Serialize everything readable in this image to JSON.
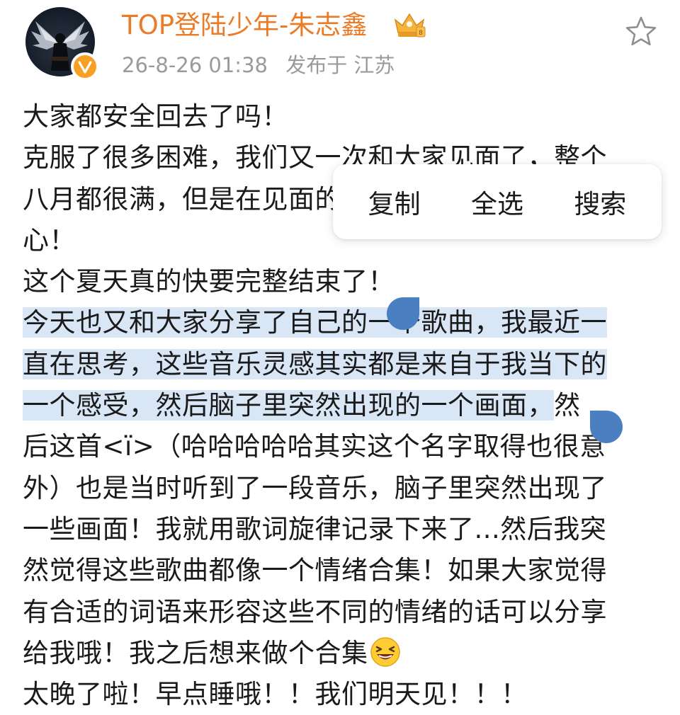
{
  "user": {
    "name": "TOP登陆少年-朱志鑫",
    "verified_color": "#f7a023",
    "name_color": "#ec7b28",
    "badge_icon": "crown-badge-icon"
  },
  "meta": {
    "timestamp": "26-8-26 01:38",
    "location": "发布于 江苏"
  },
  "context_menu": {
    "copy": "复制",
    "select_all": "全选",
    "search": "搜索"
  },
  "post": {
    "lines": [
      "大家都安全回去了吗！",
      "克服了很多困难，我们又一次和大家见面了，整个",
      "八月都很满，但是在见面的时候都非常非常开",
      "心！",
      "这个夏天真的快要完整结束了！",
      "今天也又和大家分享了自己的一个歌曲，我最近一",
      "直在思考，这些音乐灵感其实都是来自于我当下的",
      "一个感受，然后脑子里突然出现的一个画面，",
      "然",
      "后这首<ï>（哈哈哈哈哈其实这个名字取得也很意",
      "外）也是当时听到了一段音乐，脑子里突然出现了",
      "一些画面！我就用歌词旋律记录下来了...然后我突",
      "然觉得这些歌曲都像一个情绪合集！如果大家觉得",
      "有合适的词语来形容这些不同的情绪的话可以分享",
      "给我哦！我之后想来做个合集",
      "太晚了啦！早点睡哦！！我们明天见！！！"
    ],
    "selection_color": "#d8e6f6",
    "handle_color": "#4a7fc1"
  }
}
